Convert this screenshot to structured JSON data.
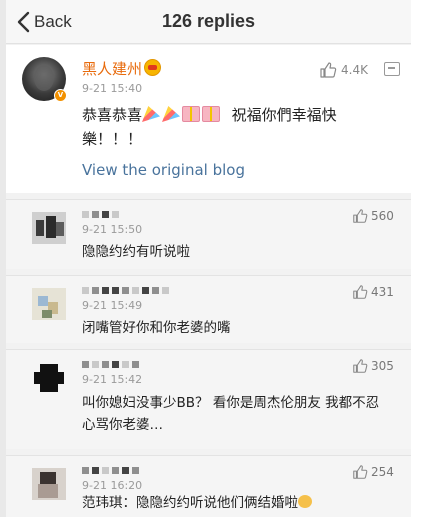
{
  "header": {
    "back_label": "Back",
    "title": "126 replies"
  },
  "main_post": {
    "user_name": "黑人建州",
    "time": "9-21 15:40",
    "like_count": "4.4K",
    "text_before_emoji": "恭喜恭喜",
    "text_after_emoji": "祝福你們幸福快樂！！！",
    "view_link": "View the original blog",
    "emojis": [
      "party-popper-icon",
      "party-popper-icon",
      "gift-icon",
      "gift-icon"
    ]
  },
  "comments": [
    {
      "time": "9-21 15:50",
      "like_count": "560",
      "text": "隐隐约约有听说啦"
    },
    {
      "time": "9-21 15:49",
      "like_count": "431",
      "text": "闭嘴管好你和你老婆的嘴"
    },
    {
      "time": "9-21 15:42",
      "like_count": "305",
      "text": "叫你媳妇没事少BB？ 看你是周杰伦朋友 我都不忍心骂你老婆…"
    },
    {
      "time": "9-21 16:20",
      "like_count": "254",
      "text": "范玮琪：隐隐约约听说他们俩结婚啦"
    }
  ],
  "colors": {
    "name_orange": "#e86b0d",
    "link_blue": "#49739c",
    "time_gray": "#9a9a9a"
  }
}
